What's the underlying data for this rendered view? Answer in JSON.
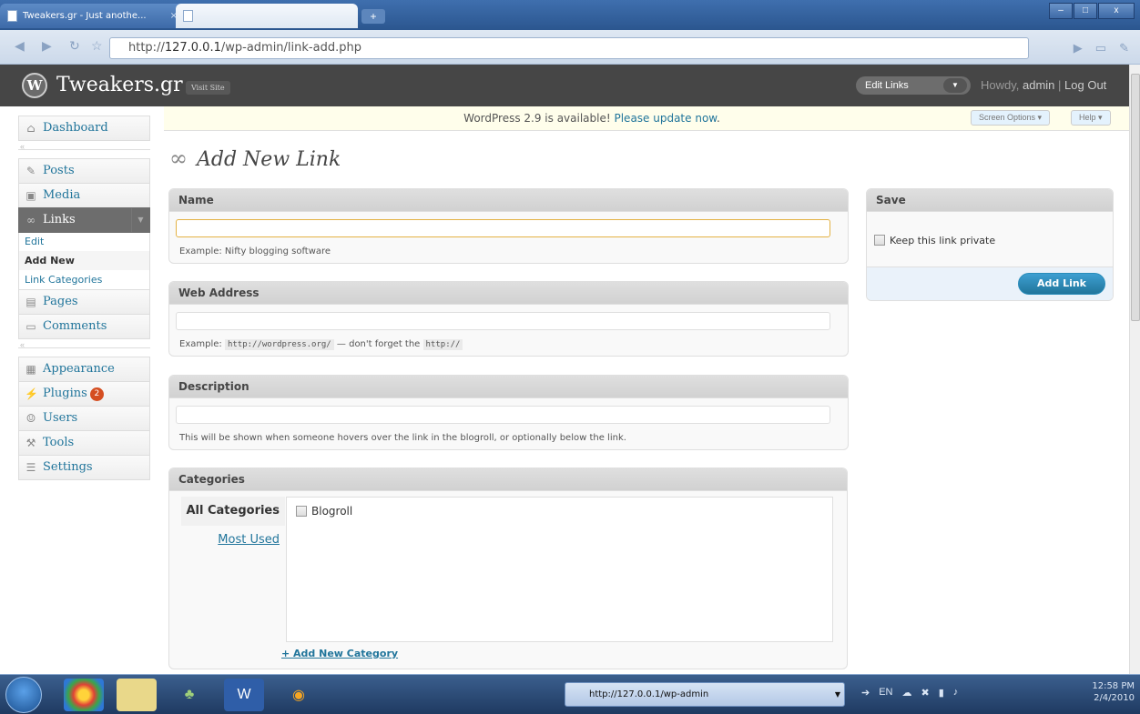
{
  "browser": {
    "tab1_title": "Tweakers.gr - Just anothe...",
    "tab1_close": "×",
    "newtab": "+",
    "url_prefix": "http://",
    "url_host": "127.0.0.1",
    "url_path": "/wp-admin/link-add.php",
    "win_min": "–",
    "win_max": "□",
    "win_close": "x"
  },
  "header": {
    "logo": "W",
    "site_title": "Tweakers.gr",
    "visit_site": "Visit Site",
    "favorite_action": "Edit Links",
    "howdy_prefix": "Howdy, ",
    "user": "admin",
    "sep": " | ",
    "logout": "Log Out"
  },
  "nag": {
    "text": "WordPress 2.9 is available! ",
    "link": "Please update now",
    "period": "."
  },
  "screen_options": "Screen Options ▾",
  "help": "Help ▾",
  "menu": {
    "dashboard": "Dashboard",
    "posts": "Posts",
    "media": "Media",
    "links": "Links",
    "links_sub": [
      "Edit",
      "Add New",
      "Link Categories"
    ],
    "pages": "Pages",
    "comments": "Comments",
    "appearance": "Appearance",
    "plugins": "Plugins",
    "plugins_badge": "2",
    "users": "Users",
    "tools": "Tools",
    "settings": "Settings"
  },
  "page_title": "Add New Link",
  "name_box": {
    "title": "Name",
    "value": "",
    "example": "Example: Nifty blogging software"
  },
  "web_box": {
    "title": "Web Address",
    "value": "",
    "example_prefix": "Example: ",
    "example_code": "http://wordpress.org/",
    "example_mid": " — don't forget the ",
    "example_code2": "http://"
  },
  "desc_box": {
    "title": "Description",
    "value": "",
    "note": "This will be shown when someone hovers over the link in the blogroll, or optionally below the link."
  },
  "cat_box": {
    "title": "Categories",
    "tab_all": "All Categories",
    "tab_used": "Most Used",
    "categories": [
      "Blogroll"
    ],
    "add_new": "+ Add New Category"
  },
  "save_box": {
    "title": "Save",
    "private_label": "Keep this link private",
    "button": "Add Link"
  },
  "taskbar": {
    "task_label": "http://127.0.0.1/wp-admin",
    "lang": "EN",
    "time": "12:58 PM",
    "date": "2/4/2010"
  }
}
